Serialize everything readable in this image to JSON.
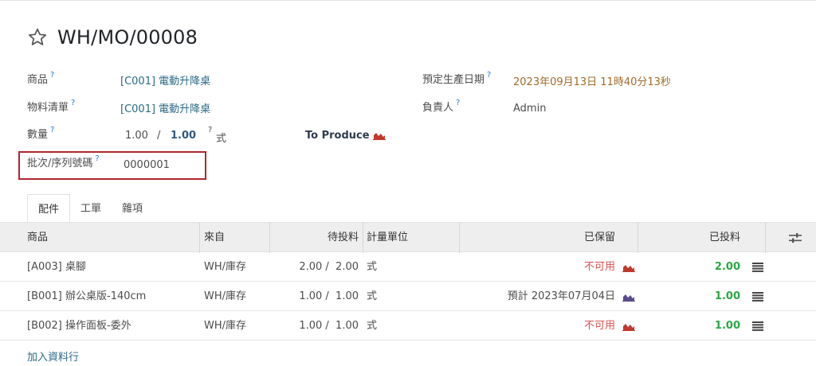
{
  "record": {
    "title": "WH/MO/00008"
  },
  "fields": {
    "product_label": "商品",
    "product_value": "[C001] 電動升降桌",
    "bom_label": "物料清單",
    "bom_value": "[C001] 電動升降桌",
    "qty_label": "數量",
    "qty_value": "1.00",
    "qty_separator": "/",
    "qty_total": "1.00",
    "qty_uom": "式",
    "to_produce": "To Produce",
    "lot_label": "批次/序列號碼",
    "lot_value": "0000001",
    "date_label": "預定生產日期",
    "date_value": "2023年09月13日 11時40分13秒",
    "responsible_label": "負責人",
    "responsible_value": "Admin",
    "help_mark": "?"
  },
  "tabs": [
    {
      "label": "配件"
    },
    {
      "label": "工單"
    },
    {
      "label": "雜項"
    }
  ],
  "table": {
    "headers": {
      "product": "商品",
      "from": "來自",
      "to_consume": "待投料",
      "uom": "計量單位",
      "reserved": "已保留",
      "consumed": "已投料"
    },
    "rows": [
      {
        "product": "[A003] 桌腳",
        "from": "WH/庫存",
        "to_consume": "2.00 /  2.00",
        "uom": "式",
        "reserved": "不可用",
        "consumed": "2.00"
      },
      {
        "product": "[B001] 辦公桌版-140cm",
        "from": "WH/庫存",
        "to_consume": "1.00 /  1.00",
        "uom": "式",
        "reserved": "預計 2023年07月04日",
        "consumed": "1.00"
      },
      {
        "product": "[B002] 操作面板-委外",
        "from": "WH/庫存",
        "to_consume": "1.00 /  1.00",
        "uom": "式",
        "reserved": "不可用",
        "consumed": "1.00"
      }
    ],
    "add_line": "加入資料行"
  },
  "colors": {
    "link": "#2b6a86",
    "date": "#a06a2a",
    "unavailable": "#d9534f",
    "consumed": "#28a745",
    "forecast_red": "#c0392b",
    "forecast_purple": "#5b4b8a",
    "highlight": "#b0272d"
  },
  "icons": {
    "star": "star-icon",
    "forecast": "area-chart-icon",
    "list": "list-icon",
    "settings": "sliders-icon"
  }
}
